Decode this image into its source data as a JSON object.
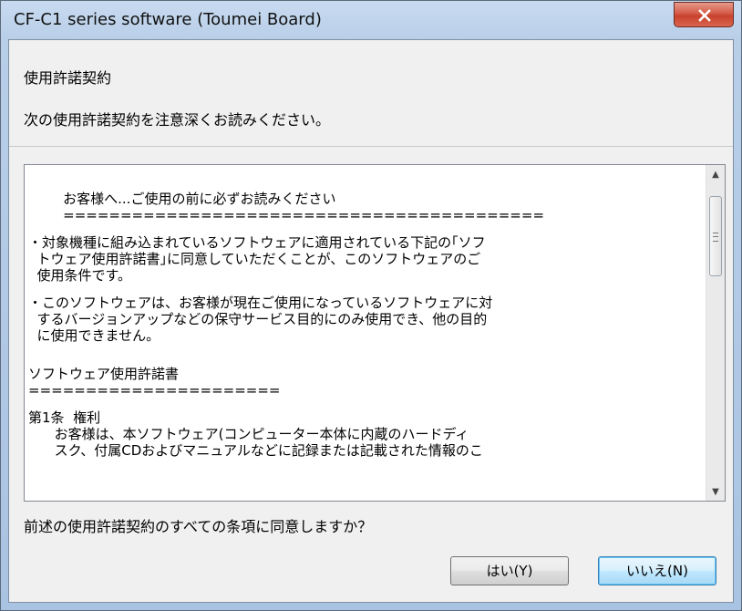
{
  "window": {
    "title": "CF-C1 series software (Toumei Board)"
  },
  "header": {
    "title": "使用許諾契約",
    "subtitle": "次の使用許諾契約を注意深くお読みください。"
  },
  "license": {
    "lines": [
      "        お客様へ...ご使用の前に必ずお読みください",
      "        ==========================================",
      "",
      "・対象機種に組み込まれているソフトウェアに適用されている下記の｢ソフ",
      "  トウェア使用許諾書｣に同意していただくことが、このソフトウェアのご",
      "  使用条件です。",
      "",
      "・このソフトウェアは、お客様が現在ご使用になっているソフトウェアに対",
      "  するバージョンアップなどの保守サービス目的にのみ使用でき、他の目的",
      "  に使用できません。",
      "",
      "",
      "ソフトウェア使用許諾書",
      "======================",
      "",
      "第1条  権利",
      "      お客様は、本ソフトウェア(コンピューター本体に内蔵のハードディ",
      "      スク、付属CDおよびマニュアルなどに記録または記載された情報のこ"
    ]
  },
  "question": "前述の使用許諾契約のすべての条項に同意しますか？",
  "buttons": {
    "yes": "はい(Y)",
    "no": "いいえ(N)"
  },
  "icons": {
    "close": "close-icon",
    "scroll_up": "scroll-up-arrow-icon",
    "scroll_down": "scroll-down-arrow-icon"
  },
  "colors": {
    "close_button": "#c8412c",
    "focused_button_border": "#3c7fb1"
  }
}
